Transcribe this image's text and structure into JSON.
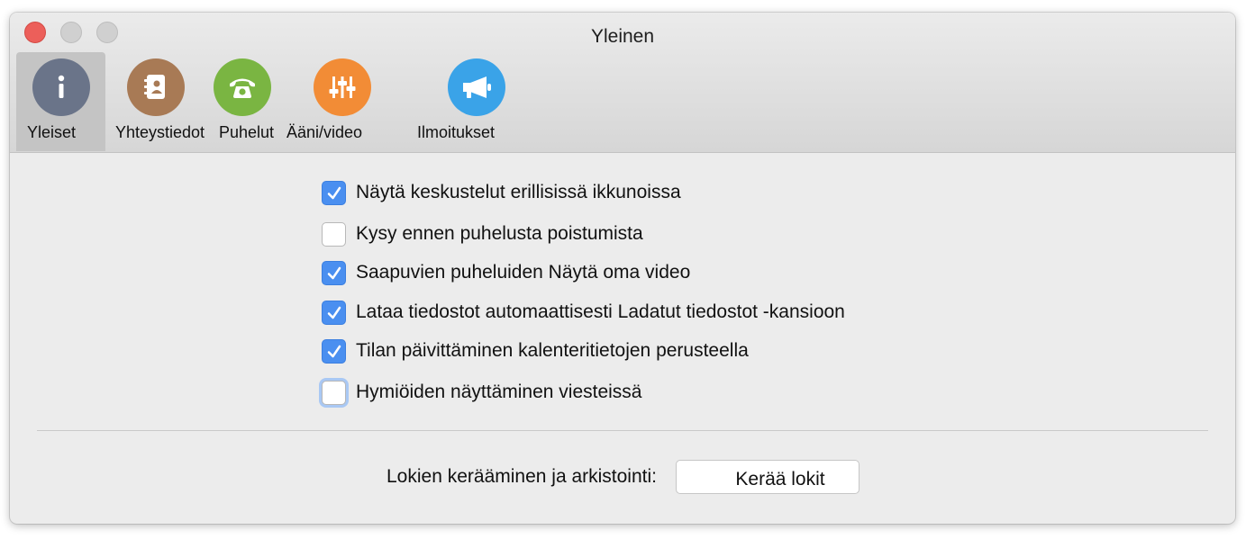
{
  "window": {
    "title": "Yleinen"
  },
  "tabs": [
    {
      "label": "Yleiset",
      "icon": "info-icon",
      "color": "#6a7489",
      "selected": true
    },
    {
      "label": "Yhteystiedot",
      "icon": "contacts-book-icon",
      "color": "#a87a55",
      "selected": false
    },
    {
      "label": "Puhelut",
      "icon": "phone-icon",
      "color": "#7ab542",
      "selected": false
    },
    {
      "label": "Ääni/video",
      "icon": "sliders-icon",
      "color": "#f28c36",
      "selected": false
    },
    {
      "label": "Ilmoitukset",
      "icon": "megaphone-icon",
      "color": "#3aa3e8",
      "selected": false
    }
  ],
  "options": [
    {
      "label": "Näytä keskustelut erillisissä ikkunoissa",
      "checked": true
    },
    {
      "label": "Kysy ennen puhelusta poistumista",
      "checked": false
    },
    {
      "label": "Saapuvien puheluiden Näytä oma video",
      "checked": true
    },
    {
      "label": "Lataa tiedostot automaattisesti Ladatut tiedostot -kansioon",
      "checked": true
    },
    {
      "label": "Tilan päivittäminen kalenteritietojen perusteella",
      "checked": true
    },
    {
      "label": "Hymiöiden näyttäminen viesteissä",
      "checked": false,
      "focused": true
    }
  ],
  "logs": {
    "label": "Lokien kerääminen ja arkistointi:",
    "button_label": "Kerää lokit"
  },
  "colors": {
    "checkbox_checked": "#4a8ff0",
    "close_button": "#ec5f5a"
  }
}
